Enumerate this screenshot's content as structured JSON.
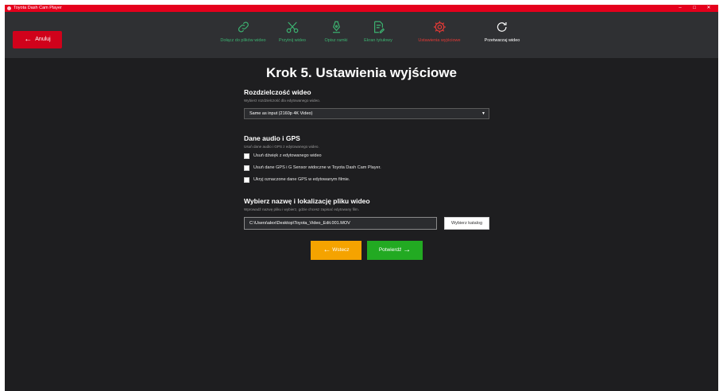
{
  "window": {
    "title": "Toyota Dash Cam Player",
    "controls": {
      "minimize": "–",
      "maximize": "□",
      "close": "✕"
    }
  },
  "toolbar": {
    "cancel_label": "Anuluj",
    "cancel_icon": "arrow-left-icon",
    "steps": [
      {
        "label": "Dołącz do plików wideo",
        "icon": "link-icon",
        "state": "done"
      },
      {
        "label": "Przytnij wideo",
        "icon": "scissors-icon",
        "state": "done"
      },
      {
        "label": "Opisz ramki",
        "icon": "pen-nib-icon",
        "state": "done"
      },
      {
        "label": "Ekran tytułowy",
        "icon": "edit-document-icon",
        "state": "done"
      },
      {
        "label": "Ustawienia wyjściowe",
        "icon": "gear-icon",
        "state": "active"
      },
      {
        "label": "Przetwarzaj wideo",
        "icon": "refresh-icon",
        "state": "pending"
      }
    ]
  },
  "main": {
    "title": "Krok 5. Ustawienia wyjściowe",
    "resolution": {
      "title": "Rozdzielczość wideo",
      "description": "Wybierz rozdzielczość dla edytowanego wideo.",
      "selected": "Same as input (2160p 4K Video)"
    },
    "audio_gps": {
      "title": "Dane audio i GPS",
      "description": "Usuń dane audio i GPS z edytowanego wideo.",
      "options": [
        {
          "label": "Usuń dźwięk z edytowanego wideo",
          "checked": false
        },
        {
          "label": "Usuń dane GPS i G Sensor widoczne w Toyota Dash Cam Player.",
          "checked": false
        },
        {
          "label": "Ukryj oznaczone dane GPS w edytowanym filmie.",
          "checked": false
        }
      ]
    },
    "file": {
      "title": "Wybierz nazwę i lokalizację pliku wideo",
      "description": "Wprowadź nazwę pliku i wybierz, gdzie chcesz zapisać edytowany film.",
      "path_value": "C:\\Users\\alex\\Desktop\\Toyota_Video_Edit.001.MOV",
      "browse_label": "Wybierz katalog"
    },
    "back_label": "Wstecz",
    "confirm_label": "Potwierdź"
  },
  "colors": {
    "titlebar": "#e5001c",
    "cancel": "#d0021b",
    "step_done": "#3cb371",
    "step_active": "#e53935",
    "back": "#f5a300",
    "confirm": "#22aa22"
  }
}
